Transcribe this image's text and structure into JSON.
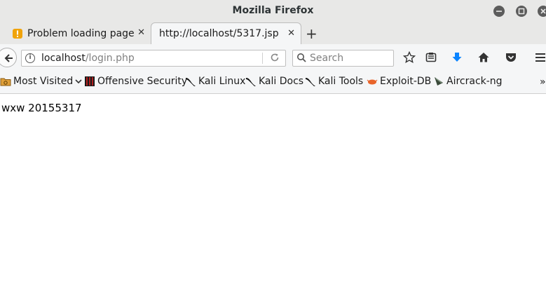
{
  "window": {
    "title": "Mozilla Firefox"
  },
  "tabs": [
    {
      "label": "Problem loading page",
      "close": "✕",
      "icon": "warning-icon"
    },
    {
      "label": "http://localhost/5317.jsp",
      "close": "✕"
    }
  ],
  "new_tab_label": "+",
  "navbar": {
    "url_host": "localhost",
    "url_path": "/login.php",
    "search_placeholder": "Search"
  },
  "bookmarks": [
    {
      "label": "Most Visited",
      "icon": "folder-icon"
    },
    {
      "label": "Offensive Security",
      "icon": "offsec-icon"
    },
    {
      "label": "Kali Linux",
      "icon": "kali-dragon-icon"
    },
    {
      "label": "Kali Docs",
      "icon": "kali-dragon-icon"
    },
    {
      "label": "Kali Tools",
      "icon": "kali-dragon-icon"
    },
    {
      "label": "Exploit-DB",
      "icon": "exploitdb-icon"
    },
    {
      "label": "Aircrack-ng",
      "icon": "aircrack-icon"
    }
  ],
  "bookmarks_overflow": "»",
  "page": {
    "text": "wxw 20155317"
  }
}
